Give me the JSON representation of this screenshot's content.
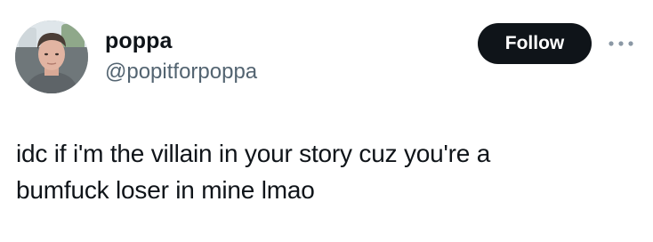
{
  "author": {
    "display_name": "poppa",
    "handle": "@popitforpoppa",
    "avatar_icon": "profile-photo"
  },
  "actions": {
    "follow_label": "Follow",
    "more_icon": "more-horizontal-icon"
  },
  "tweet": {
    "text": "idc if i'm the villain in your story cuz you're a\nbumfuck loser in mine lmao"
  },
  "colors": {
    "text_primary": "#0f1419",
    "text_secondary": "#536471",
    "follow_bg": "#0f1419",
    "follow_text": "#ffffff",
    "more_icon": "#8b98a5"
  }
}
